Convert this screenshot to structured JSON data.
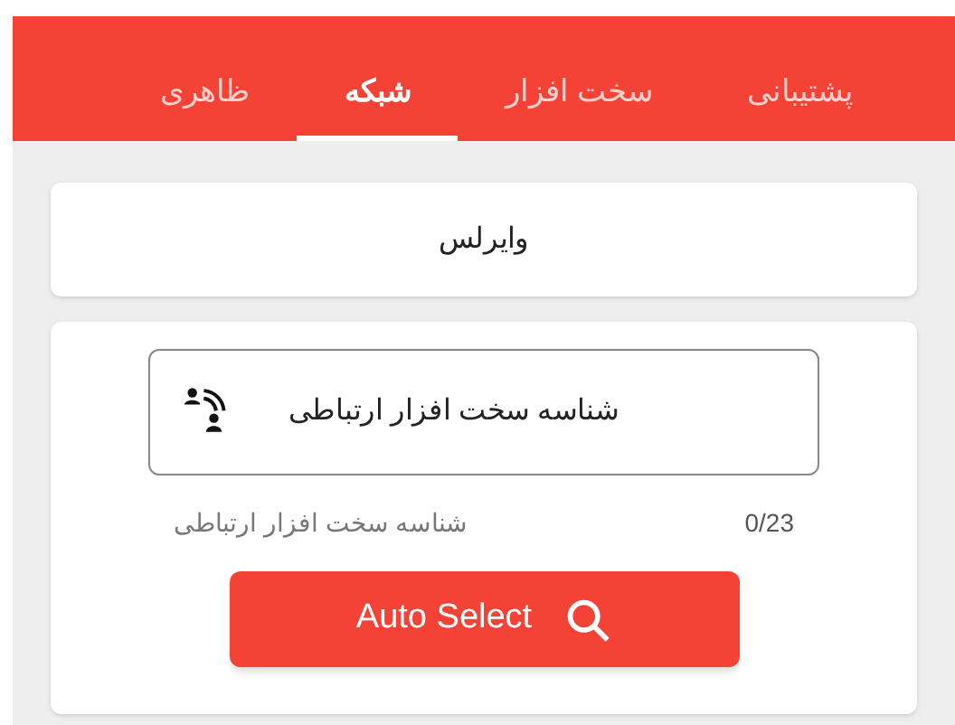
{
  "tabs": [
    {
      "label": "پشتیبانی",
      "selected": false
    },
    {
      "label": "سخت افزار",
      "selected": false
    },
    {
      "label": "شبکه",
      "selected": true
    },
    {
      "label": "ظاهری",
      "selected": false
    }
  ],
  "section_title": "وایرلس",
  "field": {
    "placeholder": "شناسه سخت افزار ارتباطی",
    "helper": "شناسه سخت افزار ارتباطی",
    "counter": "0/23"
  },
  "button": {
    "label": "Auto Select"
  }
}
